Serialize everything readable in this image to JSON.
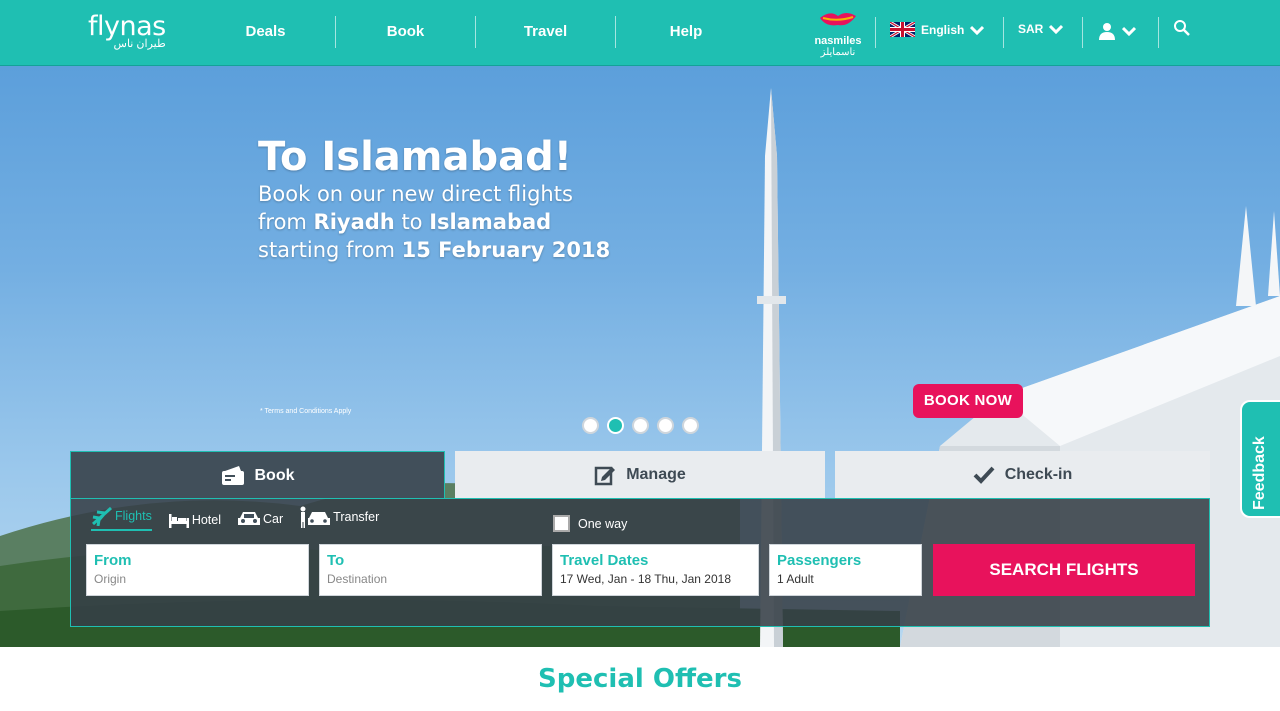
{
  "header": {
    "logo": {
      "en": "flynas",
      "ar": "طيران ناس"
    },
    "nav": [
      "Deals",
      "Book",
      "Travel",
      "Help"
    ],
    "nasmiles": {
      "en": "nasmiles",
      "ar": "ناسمايلز"
    },
    "language": "English",
    "currency": "SAR"
  },
  "hero": {
    "title": "To Islamabad!",
    "line1": "Book on our new direct flights",
    "line2_pre": "from ",
    "line2_city1": "Riyadh",
    "line2_mid": " to ",
    "line2_city2": "Islamabad",
    "line3_pre": "starting from ",
    "line3_date": "15 February 2018",
    "terms": "* Terms and Conditions Apply",
    "cta": "BOOK NOW",
    "slides_total": 5,
    "active_slide": 2
  },
  "feedback": "Feedback",
  "booking": {
    "tabs": {
      "book": "Book",
      "manage": "Manage",
      "checkin": "Check-in"
    },
    "modes": {
      "flights": "Flights",
      "hotel": "Hotel",
      "car": "Car",
      "transfer": "Transfer"
    },
    "oneway": "One way",
    "from": {
      "label": "From",
      "placeholder": "Origin"
    },
    "to": {
      "label": "To",
      "placeholder": "Destination"
    },
    "dates": {
      "label": "Travel Dates",
      "value": "17 Wed, Jan - 18 Thu, Jan 2018"
    },
    "passengers": {
      "label": "Passengers",
      "value": "1 Adult"
    },
    "search": "SEARCH FLIGHTS"
  },
  "offers_title": "Special Offers",
  "colors": {
    "brand": "#1fbfb2",
    "accent": "#e8125c",
    "panel": "#414f5a"
  }
}
